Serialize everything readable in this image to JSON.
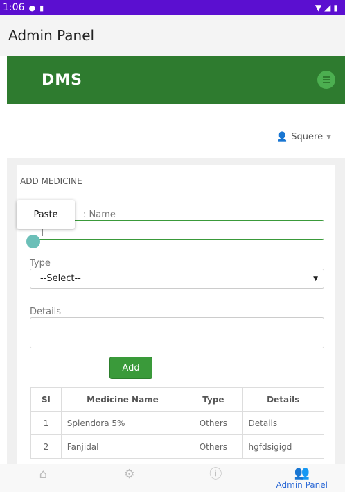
{
  "status": {
    "time": "1:06"
  },
  "app_title": "Admin Panel",
  "brand": "DMS",
  "user_name": "Squere",
  "card_title": "ADD MEDICINE",
  "paste_label": "Paste",
  "form": {
    "name_label": ": Name",
    "type_label": "Type",
    "type_selected": "--Select--",
    "details_label": "Details",
    "add_label": "Add"
  },
  "table": {
    "headers": [
      "Sl",
      "Medicine Name",
      "Type",
      "Details"
    ],
    "rows": [
      [
        "1",
        "Splendora 5%",
        "Others",
        "Details"
      ],
      [
        "2",
        "Fanjidal",
        "Others",
        "hgfdsigigd"
      ]
    ]
  },
  "nav": {
    "admin_label": "Admin Panel"
  },
  "colors": {
    "status": "#5b0fd0",
    "brand": "#2e7b2f",
    "accent": "#3a9a3a",
    "nav_active": "#2f6bd6"
  }
}
